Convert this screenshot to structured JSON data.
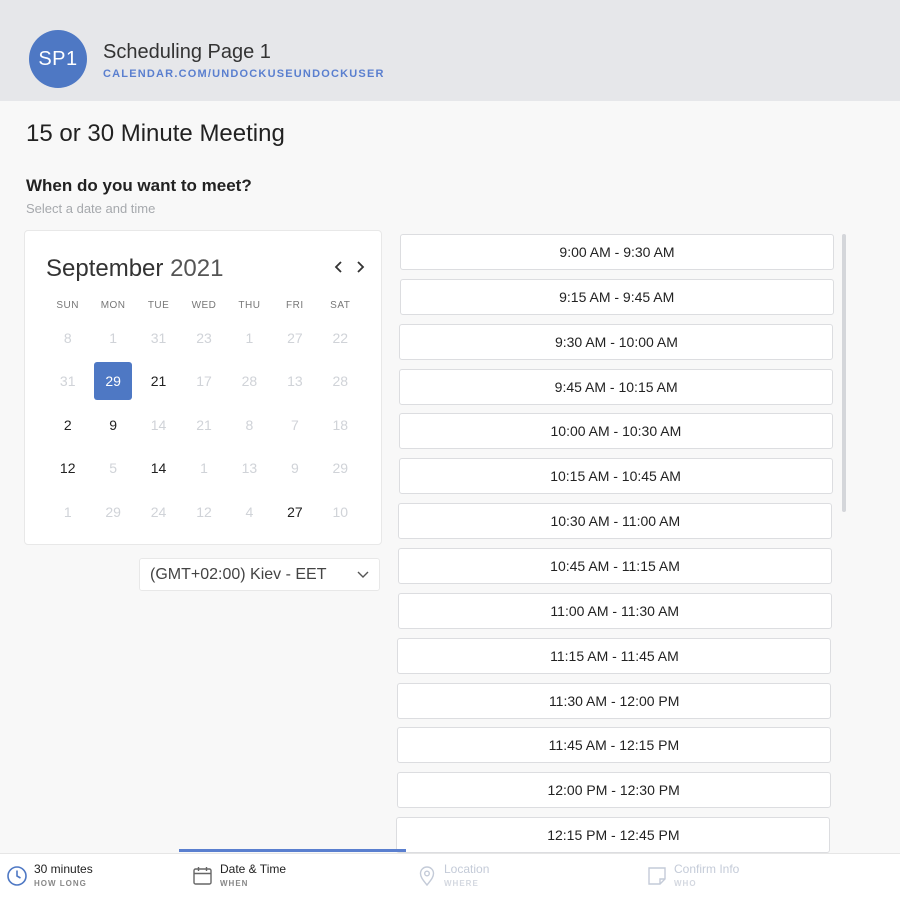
{
  "header": {
    "avatar_initials": "SP1",
    "page_name": "Scheduling Page 1",
    "page_url": "CALENDAR.COM/UNDOCKUSEUNDOCKUSER"
  },
  "meeting": {
    "title": "15 or 30 Minute Meeting",
    "question": "When do you want to meet?",
    "subtitle": "Select a date and time"
  },
  "calendar": {
    "month": "September",
    "year": "2021",
    "prev_icon": "chevron-left-icon",
    "next_icon": "chevron-right-icon",
    "weekdays": [
      "SUN",
      "MON",
      "TUE",
      "WED",
      "THU",
      "FRI",
      "SAT"
    ],
    "days": [
      {
        "label": "8",
        "state": "muted"
      },
      {
        "label": "1",
        "state": "muted"
      },
      {
        "label": "31",
        "state": "muted"
      },
      {
        "label": "23",
        "state": "muted"
      },
      {
        "label": "1",
        "state": "muted"
      },
      {
        "label": "27",
        "state": "muted"
      },
      {
        "label": "22",
        "state": "muted"
      },
      {
        "label": "31",
        "state": "muted"
      },
      {
        "label": "29",
        "state": "selected"
      },
      {
        "label": "21",
        "state": "active"
      },
      {
        "label": "17",
        "state": "muted"
      },
      {
        "label": "28",
        "state": "muted"
      },
      {
        "label": "13",
        "state": "muted"
      },
      {
        "label": "28",
        "state": "muted"
      },
      {
        "label": "2",
        "state": "active"
      },
      {
        "label": "9",
        "state": "active"
      },
      {
        "label": "14",
        "state": "muted"
      },
      {
        "label": "21",
        "state": "muted"
      },
      {
        "label": "8",
        "state": "muted"
      },
      {
        "label": "7",
        "state": "muted"
      },
      {
        "label": "18",
        "state": "muted"
      },
      {
        "label": "12",
        "state": "active"
      },
      {
        "label": "5",
        "state": "muted"
      },
      {
        "label": "14",
        "state": "active"
      },
      {
        "label": "1",
        "state": "muted"
      },
      {
        "label": "13",
        "state": "muted"
      },
      {
        "label": "9",
        "state": "muted"
      },
      {
        "label": "29",
        "state": "muted"
      },
      {
        "label": "1",
        "state": "muted"
      },
      {
        "label": "29",
        "state": "muted"
      },
      {
        "label": "24",
        "state": "muted"
      },
      {
        "label": "12",
        "state": "muted"
      },
      {
        "label": "4",
        "state": "muted"
      },
      {
        "label": "27",
        "state": "active"
      },
      {
        "label": "10",
        "state": "muted"
      }
    ]
  },
  "timezone": {
    "value": "(GMT+02:00) Kiev - EET",
    "icon": "chevron-down-icon"
  },
  "time_slots": [
    "9:00 AM - 9:30 AM",
    "9:15 AM - 9:45 AM",
    "9:30 AM - 10:00 AM",
    "9:45 AM - 10:15 AM",
    "10:00 AM - 10:30 AM",
    "10:15 AM - 10:45 AM",
    "10:30 AM - 11:00 AM",
    "10:45 AM - 11:15 AM",
    "11:00 AM - 11:30 AM",
    "11:15 AM - 11:45 AM",
    "11:30 AM - 12:00 PM",
    "11:45 AM - 12:15 PM",
    "12:00 PM - 12:30 PM",
    "12:15 PM - 12:45 PM"
  ],
  "footer": {
    "steps": [
      {
        "label": "30 minutes",
        "sub": "HOW LONG",
        "icon": "clock-icon",
        "state": "done"
      },
      {
        "label": "Date & Time",
        "sub": "WHEN",
        "icon": "calendar-icon",
        "state": "current"
      },
      {
        "label": "Location",
        "sub": "WHERE",
        "icon": "location-pin-icon",
        "state": "disabled"
      },
      {
        "label": "Confirm Info",
        "sub": "WHO",
        "icon": "note-icon",
        "state": "disabled"
      }
    ]
  },
  "colors": {
    "accent": "#4e78c4",
    "link": "#5a7fcf",
    "muted_text": "#d0d3d8",
    "header_bg": "#e6e7ea"
  }
}
